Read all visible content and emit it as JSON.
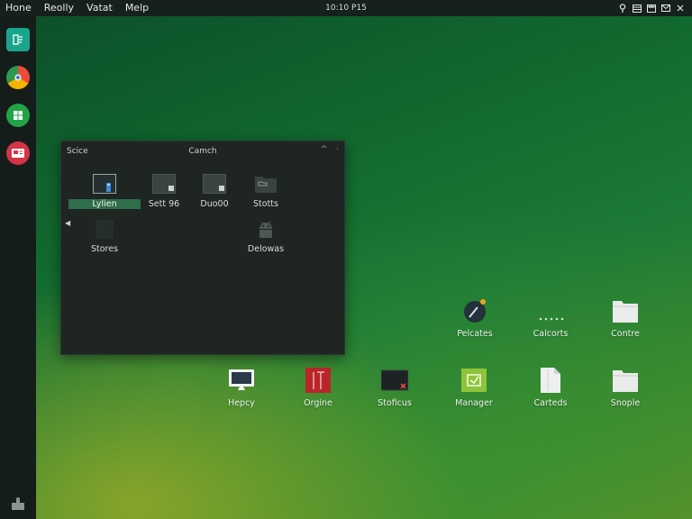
{
  "menubar": {
    "items": [
      "Hone",
      "Reolly",
      "Vatat",
      "Melp"
    ],
    "clock": "10:10 P15"
  },
  "window": {
    "left_label": "Scice",
    "title": "Camch",
    "controls": [
      "^",
      "·"
    ],
    "files": [
      {
        "label": "Lylien",
        "icon": "device-icon",
        "selected": true
      },
      {
        "label": "Sett 96",
        "icon": "screen-folder-icon",
        "selected": false
      },
      {
        "label": "Duo00",
        "icon": "screen-folder-icon",
        "selected": false
      },
      {
        "label": "Stotts",
        "icon": "folder-icon",
        "selected": false
      },
      {
        "label": "Stores",
        "icon": "bin-icon",
        "selected": false
      },
      {
        "label": "Delowas",
        "icon": "android-icon",
        "selected": false
      }
    ]
  },
  "desktop_icons": [
    {
      "label": "Pelcates",
      "icon": "paint-icon"
    },
    {
      "label": "Calcorts",
      "icon": "dots-icon"
    },
    {
      "label": "Contre",
      "icon": "folder-icon"
    },
    {
      "label": "Hepcy",
      "icon": "monitor-icon"
    },
    {
      "label": "Orgine",
      "icon": "red-book-icon"
    },
    {
      "label": "Stoficus",
      "icon": "terminal-icon"
    },
    {
      "label": "Manager",
      "icon": "manager-icon"
    },
    {
      "label": "Carteds",
      "icon": "document-icon"
    },
    {
      "label": "Snople",
      "icon": "folder-icon"
    }
  ],
  "colors": {
    "accent": "#2f6e4a",
    "bar": "#16201c",
    "dock": "#141d1a"
  }
}
